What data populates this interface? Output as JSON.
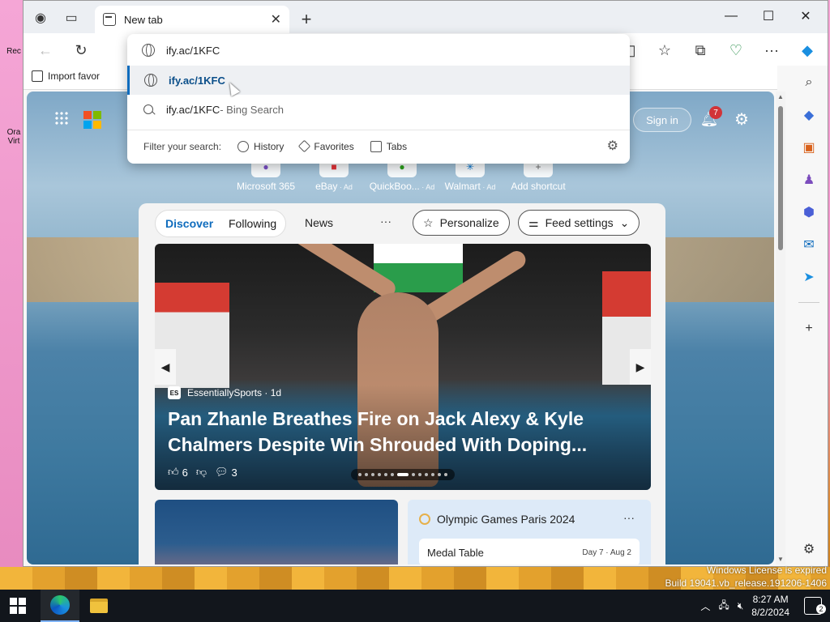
{
  "desktop": {
    "icon_labels": [
      "Rec",
      "Ora",
      "Virt"
    ],
    "watermark_line1": "Windows License is expired",
    "watermark_line2": "Build 19041.vb_release.191206-1406"
  },
  "browser": {
    "tab": {
      "title": "New tab",
      "close": "✕"
    },
    "new_tab_symbol": "+",
    "window_controls": {
      "minimize": "—",
      "maximize": "☐",
      "close": "✕"
    },
    "toolbar": {
      "back": "←",
      "refresh": "↻",
      "more": "···"
    },
    "bookmarks_bar": {
      "import_label": "Import favor"
    },
    "omnibox": {
      "input_value": "ify.ac/1KFC",
      "suggestions": [
        {
          "text": "ify.ac/1KFC",
          "suffix": "",
          "type": "url"
        },
        {
          "text": "ify.ac/1KFC",
          "suffix": " - Bing Search",
          "type": "search"
        }
      ],
      "filter_label": "Filter your search:",
      "filters": [
        "History",
        "Favorites",
        "Tabs"
      ]
    }
  },
  "newtab": {
    "sign_in": "Sign in",
    "notification_count": "7",
    "shortcuts": [
      {
        "label": "Microsoft 365",
        "ad": ""
      },
      {
        "label": "eBay",
        "ad": " · Ad"
      },
      {
        "label": "QuickBoo...",
        "ad": " · Ad"
      },
      {
        "label": "Walmart",
        "ad": " · Ad"
      },
      {
        "label": "Add shortcut",
        "ad": ""
      }
    ],
    "feed": {
      "tabs": [
        "Discover",
        "Following"
      ],
      "news_tab": "News",
      "more": "···",
      "personalize": "Personalize",
      "feed_settings": "Feed settings",
      "hero": {
        "source": "EssentiallySports · 1d",
        "source_logo": "ES",
        "title": "Pan Zhanle Breathes Fire on Jack Alexy & Kyle Chalmers Despite Win Shrouded With Doping...",
        "likes": "6",
        "comments": "3"
      },
      "olympics_card": {
        "title": "Olympic Games Paris 2024",
        "more": "···",
        "medal_table": "Medal Table",
        "dates": "Day 7 · Aug 2"
      }
    }
  },
  "taskbar": {
    "time": "8:27 AM",
    "date": "8/2/2024",
    "notification_count": "2"
  },
  "colors": {
    "accent": "#0f6cbd",
    "taskbar": "#12161c",
    "badge": "#d13438"
  }
}
